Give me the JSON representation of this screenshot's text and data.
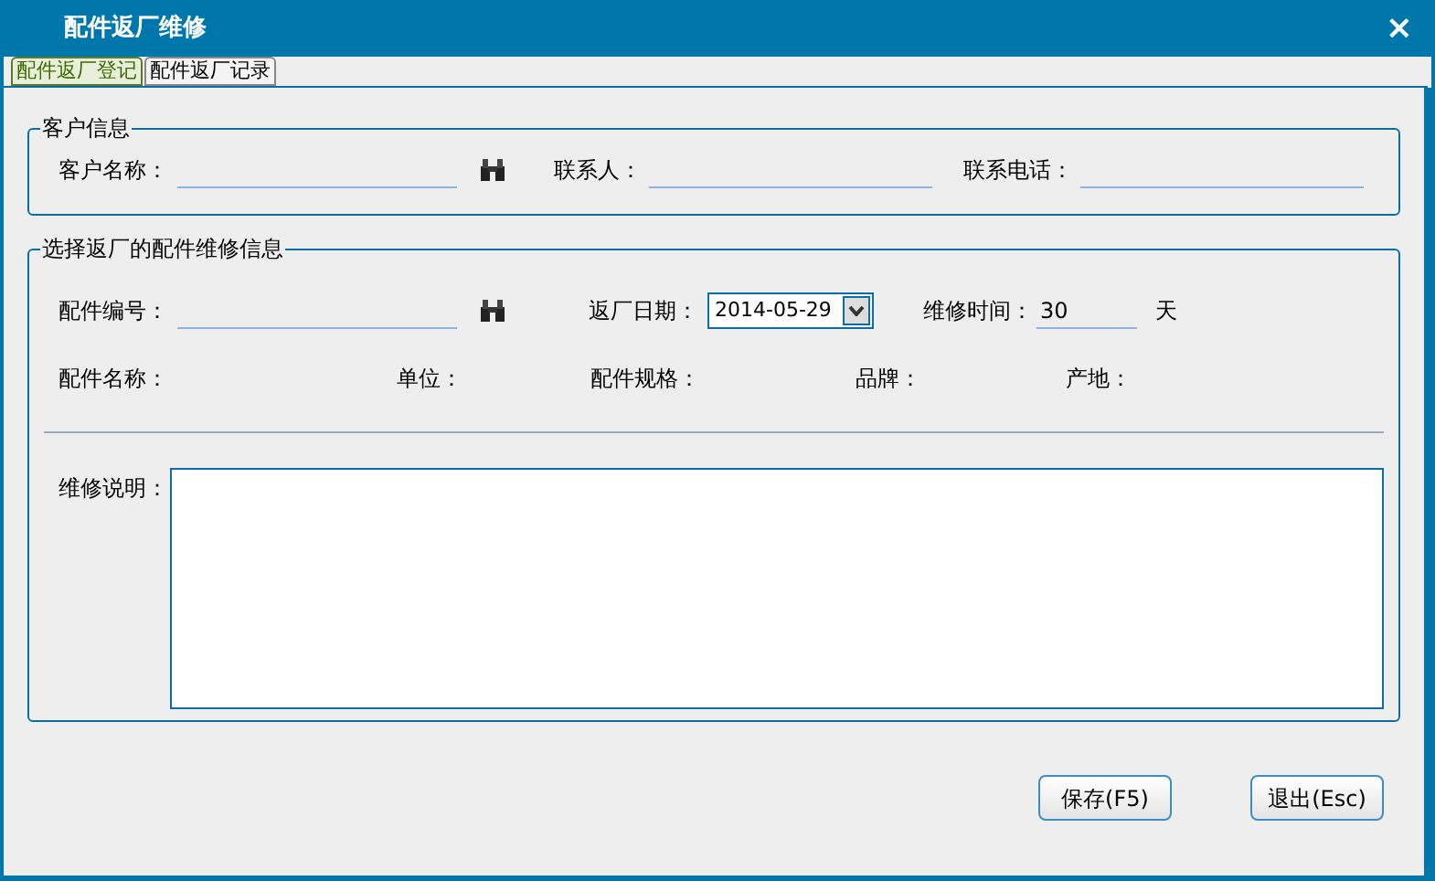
{
  "window": {
    "title": "配件返厂维修",
    "close": "×"
  },
  "tabs": [
    {
      "label": "配件返厂登记",
      "selected": true
    },
    {
      "label": "配件返厂记录",
      "selected": false
    }
  ],
  "customer_section": {
    "title": "客户信息",
    "fields": [
      {
        "label": "客户名称：",
        "kind": "lookup"
      },
      {
        "label": "联系人：",
        "kind": "text"
      },
      {
        "label": "联系电话：",
        "kind": "text"
      }
    ]
  },
  "part_section": {
    "title": "选择返厂的配件维修信息",
    "fields": [
      {
        "label": "配件编号：",
        "kind": "lookup"
      },
      {
        "label": "返厂日期：",
        "kind": "dropdown",
        "value": "2014-05-29"
      },
      {
        "label": "维修时间：",
        "kind": "text",
        "value": "30",
        "unit": "天"
      }
    ],
    "info_labels": [
      "配件名称：",
      "单位：",
      "配件规格：",
      "品牌：",
      "产地："
    ],
    "notes_label": "维修说明："
  },
  "buttons": [
    "保存(F5)",
    "退出(Esc)"
  ]
}
